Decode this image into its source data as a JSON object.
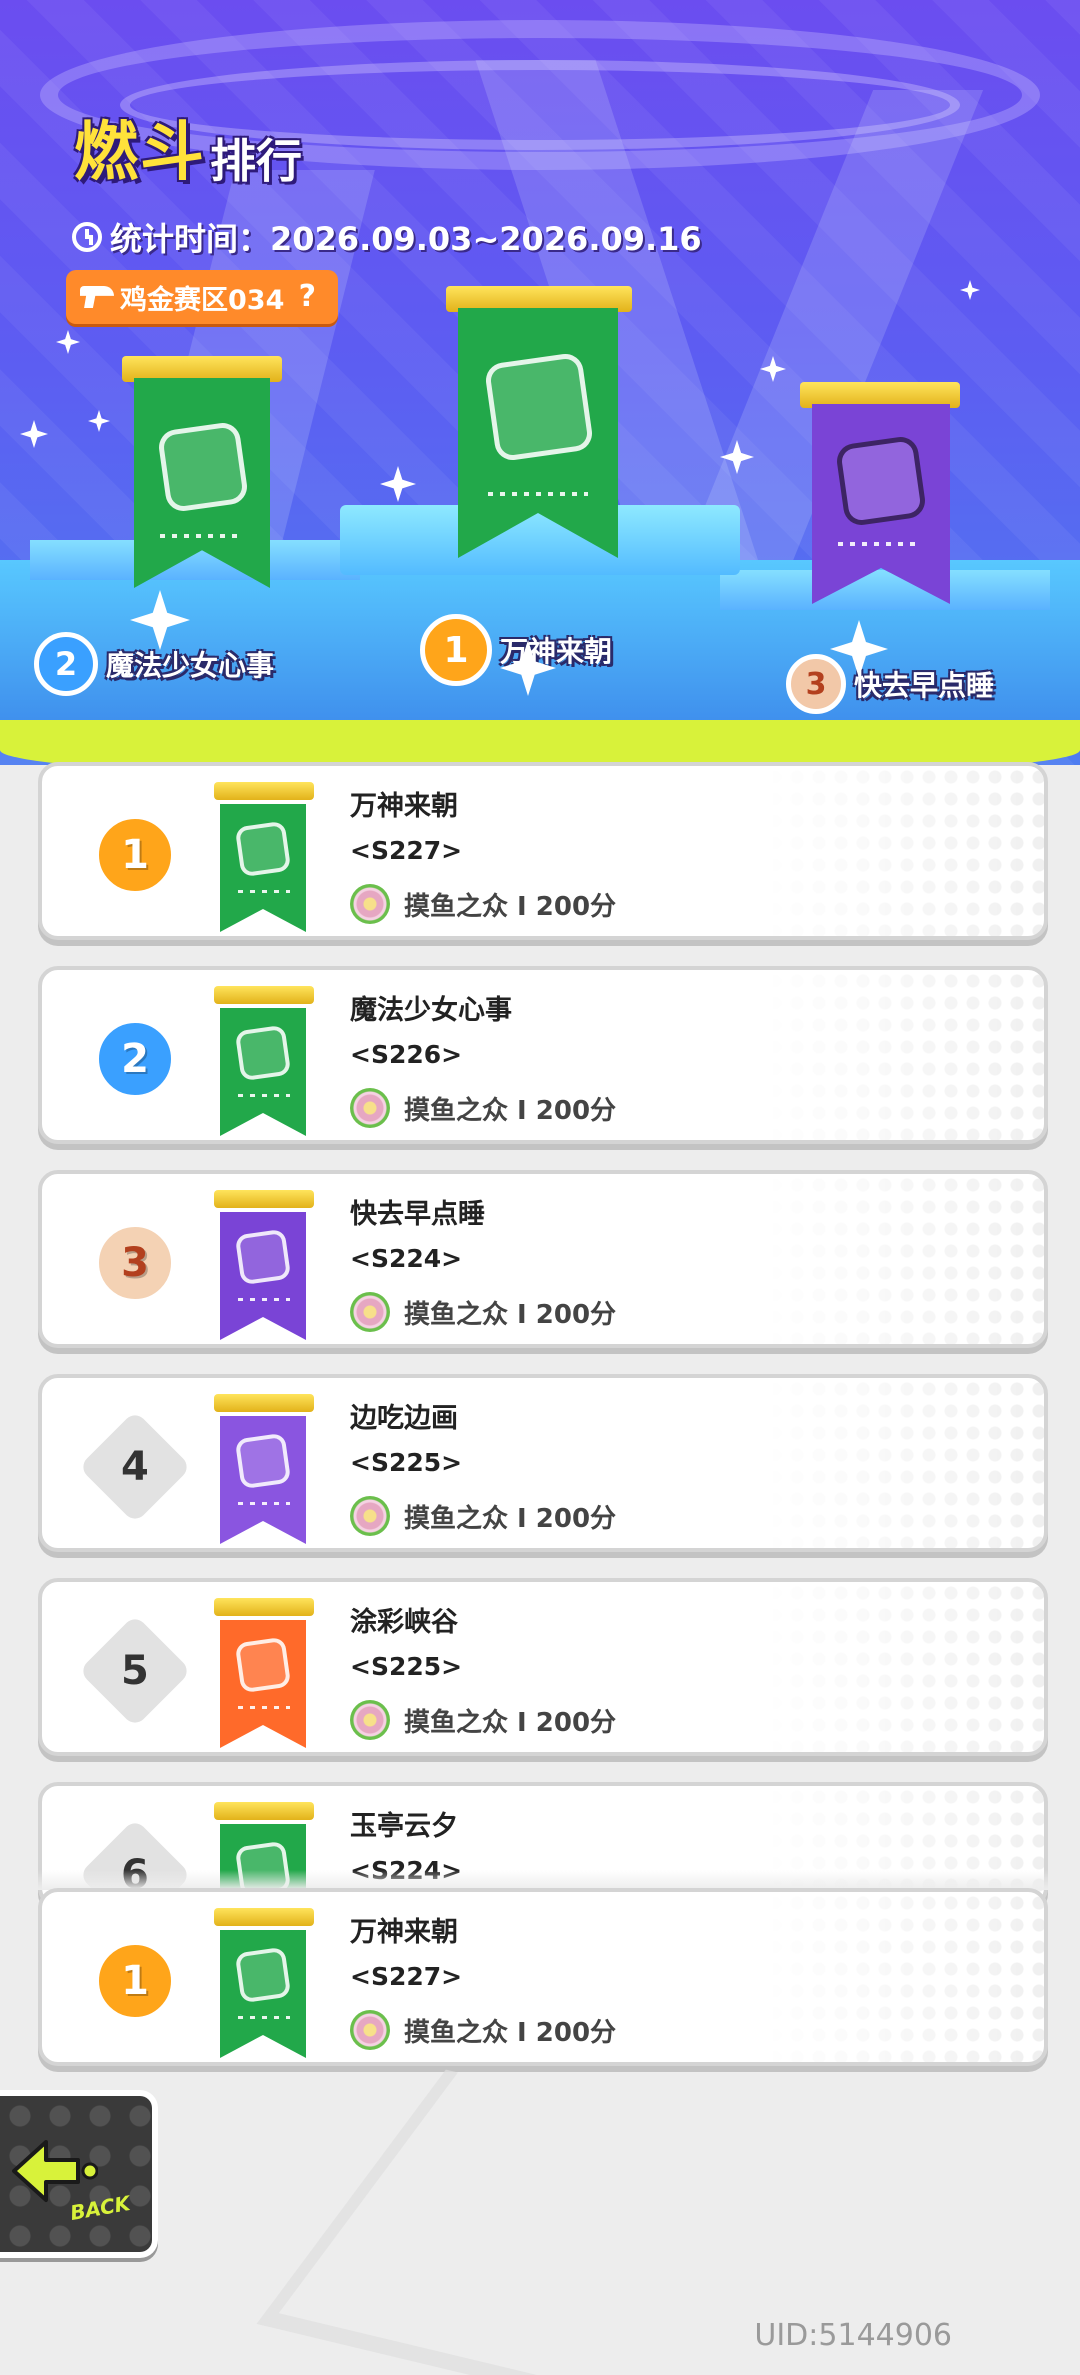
{
  "header": {
    "title_main": "燃斗",
    "title_sub": "排行",
    "time_label": "统计时间：2026.09.03~2026.09.16",
    "zone_label": "鸡金赛区034",
    "help_glyph": "?"
  },
  "podium": [
    {
      "rank": "2",
      "name": "魔法少女心事",
      "color": "#22a84a"
    },
    {
      "rank": "1",
      "name": "万神来朝",
      "color": "#22a84a"
    },
    {
      "rank": "3",
      "name": "快去早点睡",
      "color": "#7a44d6"
    }
  ],
  "list": [
    {
      "rank": "1",
      "name": "万神来朝",
      "server": "<S227>",
      "tier": "摸鱼之众 I  200分",
      "banner_color": "#22a84a",
      "badge": "gold"
    },
    {
      "rank": "2",
      "name": "魔法少女心事",
      "server": "<S226>",
      "tier": "摸鱼之众 I  200分",
      "banner_color": "#22a84a",
      "badge": "blue"
    },
    {
      "rank": "3",
      "name": "快去早点睡",
      "server": "<S224>",
      "tier": "摸鱼之众 I  200分",
      "banner_color": "#7a44d6",
      "badge": "bronze"
    },
    {
      "rank": "4",
      "name": "边吃边画",
      "server": "<S225>",
      "tier": "摸鱼之众 I  200分",
      "banner_color": "#8a55e0",
      "badge": "plain"
    },
    {
      "rank": "5",
      "name": "涂彩峡谷",
      "server": "<S225>",
      "tier": "摸鱼之众 I  200分",
      "banner_color": "#ff6a2a",
      "badge": "plain"
    },
    {
      "rank": "6",
      "name": "玉亭云夕",
      "server": "<S224>",
      "tier": "",
      "banner_color": "#22a84a",
      "badge": "plain"
    }
  ],
  "my_team": {
    "rank": "1",
    "name": "万神来朝",
    "server": "<S227>",
    "tier": "摸鱼之众 I  200分",
    "banner_color": "#22a84a",
    "badge": "gold"
  },
  "footer": {
    "back_label": "BACK",
    "uid": "UID:5144906"
  },
  "colors": {
    "accent_yellow": "#ffe23a",
    "slime": "#d8f23a",
    "zone_orange": "#ff8a2a"
  }
}
